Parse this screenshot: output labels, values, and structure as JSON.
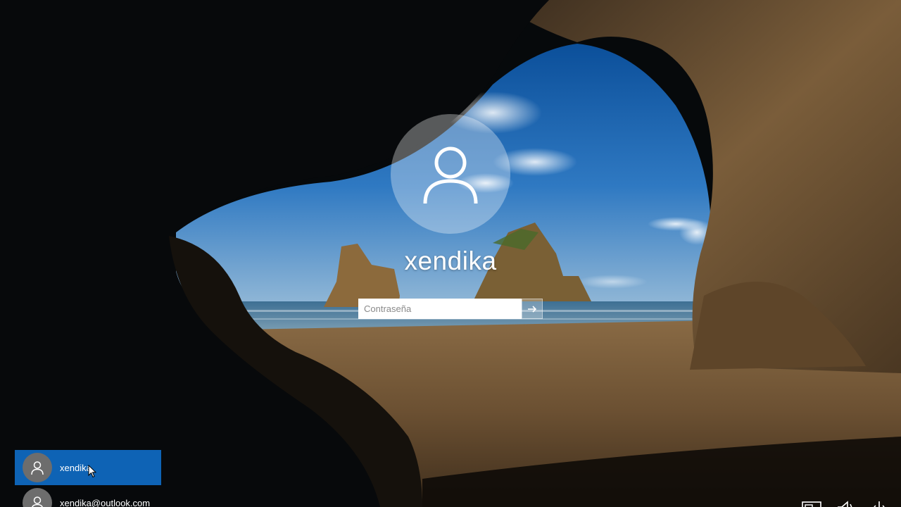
{
  "lockscreen": {
    "user_name": "xendika",
    "password": {
      "placeholder": "Contraseña",
      "value": ""
    },
    "submit_icon": "arrow-right-icon",
    "avatar_icon": "user-icon"
  },
  "user_switcher": {
    "items": [
      {
        "label": "xendika",
        "selected": true,
        "icon": "user-icon"
      },
      {
        "label": "xendika@outlook.com",
        "selected": false,
        "icon": "user-icon"
      }
    ]
  },
  "system_tray": {
    "icons": [
      "network-icon",
      "accessibility-icon",
      "power-icon"
    ]
  },
  "colors": {
    "selected_user_bg": "#0e63b5",
    "avatar_circle": "#6d6d6d",
    "text": "#ffffff"
  }
}
